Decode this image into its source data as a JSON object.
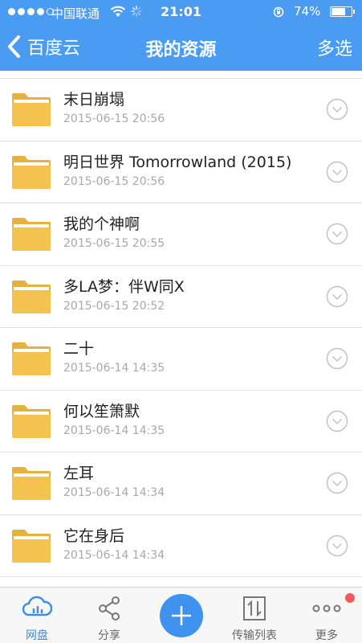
{
  "status_bar": {
    "carrier": "中国联通",
    "time": "21:01",
    "battery_percent": "74%",
    "battery_level": 0.74,
    "signal_bars_filled": 4,
    "signal_bars_total": 5
  },
  "nav": {
    "back_label": "百度云",
    "title": "我的资源",
    "multi_select_label": "多选"
  },
  "files": [
    {
      "name": "末日崩塌",
      "date": "2015-06-15 20:56"
    },
    {
      "name": "明日世界 Tomorrowland (2015)",
      "date": "2015-06-15 20:56"
    },
    {
      "name": "我的个神啊",
      "date": "2015-06-15 20:55"
    },
    {
      "name": "多LA梦：伴W同X",
      "date": "2015-06-15 20:52"
    },
    {
      "name": "二十",
      "date": "2015-06-14 14:35"
    },
    {
      "name": "何以笙箫默",
      "date": "2015-06-14 14:35"
    },
    {
      "name": "左耳",
      "date": "2015-06-14 14:34"
    },
    {
      "name": "它在身后",
      "date": "2015-06-14 14:34"
    },
    {
      "name": "",
      "date": ""
    }
  ],
  "tabs": [
    {
      "label": "网盘",
      "icon": "cloud-icon",
      "active": true
    },
    {
      "label": "分享",
      "icon": "share-icon",
      "active": false
    },
    {
      "label": "",
      "icon": "plus-icon",
      "active": false
    },
    {
      "label": "传输列表",
      "icon": "transfer-icon",
      "active": false
    },
    {
      "label": "更多",
      "icon": "more-icon",
      "active": false
    }
  ],
  "colors": {
    "header_bg": "#4a9cf2",
    "folder": "#f3c24f",
    "accent": "#3f92ee",
    "badge": "#f25a5a"
  }
}
